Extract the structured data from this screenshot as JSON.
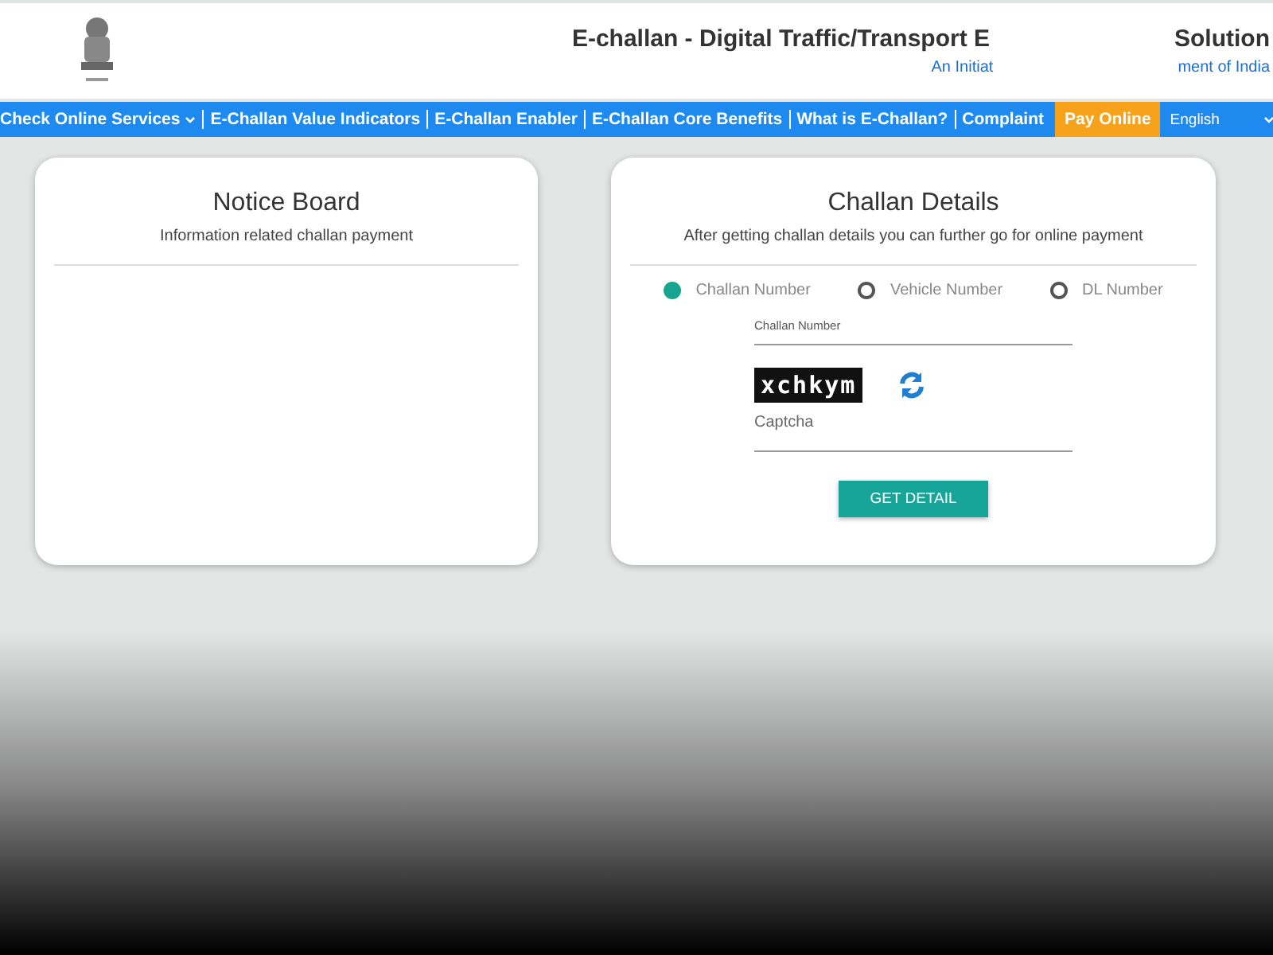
{
  "header": {
    "title_parts": [
      "E-challan - Digital Traffic/Transport E",
      "Solution"
    ],
    "subtitle_parts": [
      "An Initiat",
      "ment of India"
    ]
  },
  "nav": {
    "items": [
      {
        "label": "Check Online Services",
        "kind": "dropdown"
      },
      {
        "label": "E-Challan Value Indicators",
        "kind": "link"
      },
      {
        "label": "E-Challan Enabler",
        "kind": "link"
      },
      {
        "label": "E-Challan Core Benefits",
        "kind": "link"
      },
      {
        "label": "What is E-Challan?",
        "kind": "link"
      },
      {
        "label": "Complaint",
        "kind": "link"
      },
      {
        "label": "Pay Online",
        "kind": "highlight"
      }
    ],
    "language": "English"
  },
  "notice_board": {
    "title": "Notice Board",
    "subtitle": "Information related challan payment"
  },
  "challan_details": {
    "title": "Challan Details",
    "subtitle": "After getting challan details you can further go for online payment",
    "options": [
      {
        "label": "Challan Number",
        "selected": true
      },
      {
        "label": "Vehicle Number",
        "selected": false
      },
      {
        "label": "DL Number",
        "selected": false
      }
    ],
    "number_field": {
      "label": "Challan Number"
    },
    "captcha_text": "xchkym",
    "captcha_field": {
      "placeholder": "Captcha"
    },
    "button": "GET DETAIL"
  }
}
